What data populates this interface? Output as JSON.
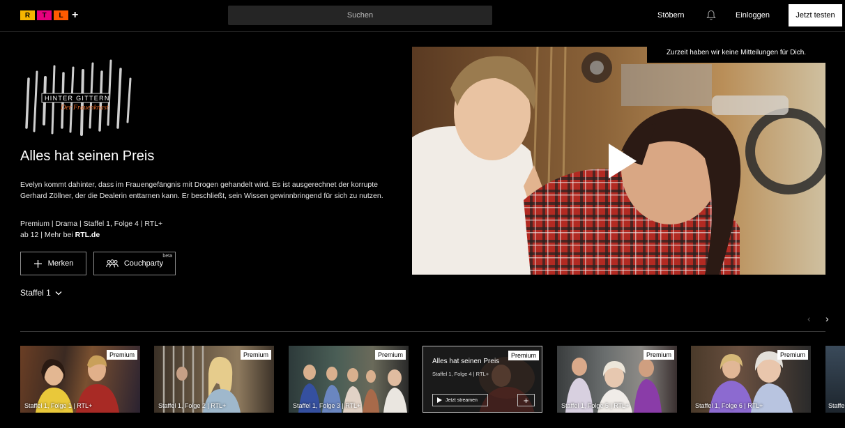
{
  "header": {
    "logo_letters": [
      "R",
      "T",
      "L"
    ],
    "logo_plus": "+",
    "search_placeholder": "Suchen",
    "browse": "Stöbern",
    "login": "Einloggen",
    "trial_button": "Jetzt testen"
  },
  "show": {
    "logo_line1": "HINTER GITTERN",
    "logo_line2": "Der Frauenknast"
  },
  "episode_detail": {
    "title": "Alles hat seinen Preis",
    "description": "Evelyn kommt dahinter, dass im Frauengefängnis mit Drogen gehandelt wird. Es ist ausgerechnet der korrupte Gerhard Zöllner, der die Dealerin enttarnen kann. Er beschließt, sein Wissen gewinnbringend für sich zu nutzen.",
    "meta_line1": "Premium | Drama | Staffel 1, Folge 4 | RTL+",
    "meta_line2_prefix": "ab 12 | Mehr bei ",
    "meta_line2_link": "RTL.de",
    "bookmark_label": "Merken",
    "couchparty_label": "Couchparty",
    "couchparty_badge": "beta",
    "season_selector": "Staffel 1"
  },
  "notification": "Zurzeit haben wir keine Mitteilungen für Dich.",
  "episodes": [
    {
      "label": "Staffel 1, Folge 1 | RTL+",
      "badge": "Premium"
    },
    {
      "label": "Staffel 1, Folge 2 | RTL+",
      "badge": "Premium"
    },
    {
      "label": "Staffel 1, Folge 3 | RTL+",
      "badge": "Premium"
    },
    {
      "title": "Alles hat seinen Preis",
      "label": "Staffel 1, Folge 4 | RTL+",
      "badge": "Premium",
      "stream_label": "Jetzt streamen",
      "add_label": "+"
    },
    {
      "label": "Staffel 1, Folge 5 | RTL+",
      "badge": "Premium"
    },
    {
      "label": "Staffel 1, Folge 6 | RTL+",
      "badge": "Premium"
    },
    {
      "label": "Staffel"
    }
  ],
  "carousel": {
    "prev": "‹",
    "next": "›"
  },
  "colors": {
    "logo_r": "#f7b500",
    "logo_t": "#e6007e",
    "logo_l": "#ff5b00",
    "background": "#000000"
  }
}
